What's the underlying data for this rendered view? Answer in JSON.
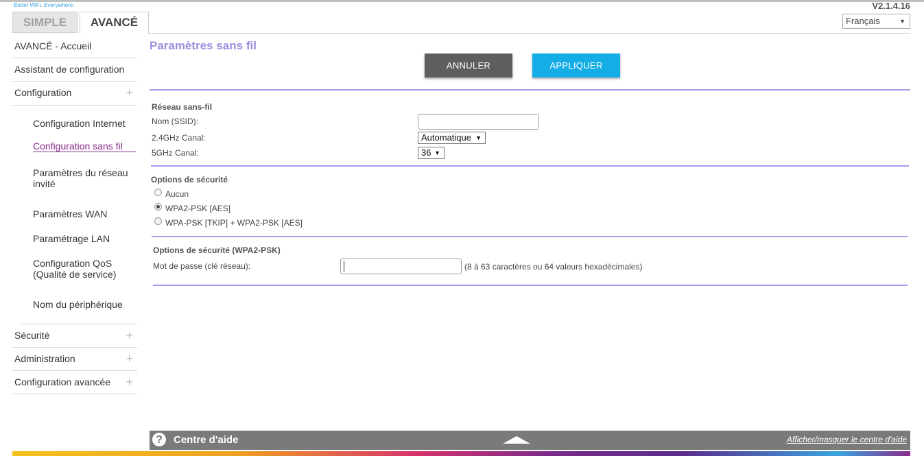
{
  "header": {
    "tagline": "Better WiFi. Everywhere.",
    "version": "V2.1.4.16",
    "language": "Français",
    "tabs": {
      "simple": "SIMPLE",
      "advanced": "AVANCÉ"
    }
  },
  "sidebar": {
    "home": "AVANCÉ - Accueil",
    "setup_wizard": "Assistant de configuration",
    "configuration": "Configuration",
    "sub_items": {
      "internet": "Configuration Internet",
      "wireless": "Configuration sans fil",
      "guest": "Paramètres du réseau invité",
      "wan": "Paramètres WAN",
      "lan": "Paramétrage LAN",
      "qos": "Configuration QoS (Qualité de service)",
      "device_name": "Nom du périphérique"
    },
    "security": "Sécurité",
    "administration": "Administration",
    "advanced_setup": "Configuration avancée"
  },
  "main": {
    "title": "Paramètres sans fil",
    "cancel": "ANNULER",
    "apply": "APPLIQUER",
    "wireless_section": "Réseau sans-fil",
    "ssid_label": "Nom (SSID):",
    "ssid_value": "",
    "channel24_label": "2.4GHz Canal:",
    "channel24_value": "Automatique",
    "channel5_label": "5GHz Canal:",
    "channel5_value": "36",
    "security_section": "Options de sécurité",
    "security_options": [
      "Aucun",
      "WPA2-PSK [AES]",
      "WPA-PSK [TKIP] + WPA2-PSK [AES]"
    ],
    "security_selected": "WPA2-PSK [AES]",
    "wpa2_section": "Options de sécurité (WPA2-PSK)",
    "password_label": "Mot de passe (clé réseau):",
    "password_value": "",
    "password_hint": "(8 à 63 caractères ou 64 valeurs hexadécimales)"
  },
  "help": {
    "title": "Centre d'aide",
    "toggle": "Afficher/masquer le centre d'aide"
  },
  "colors": {
    "accent_purple": "#9b8ee0",
    "active_nav": "#8a2a8a",
    "apply_button": "#14ade6",
    "cancel_button": "#5e5e5e"
  }
}
